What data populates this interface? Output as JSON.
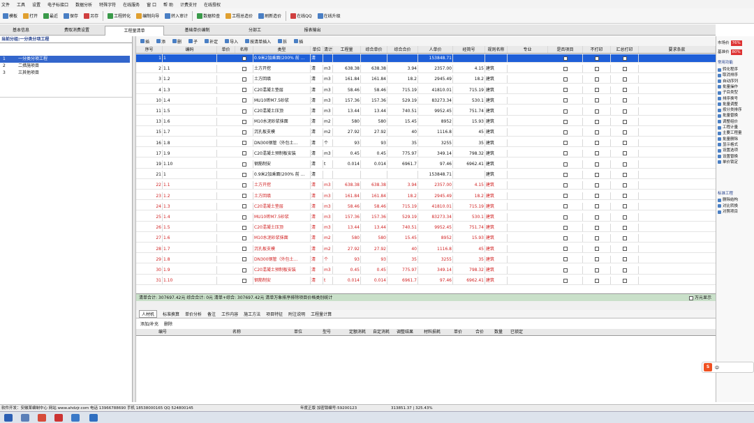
{
  "menu": [
    "文件",
    "工具",
    "设置",
    "电子标接口",
    "数据分析",
    "特殊字符",
    "在线服务",
    "窗 口",
    "帮 助",
    "计费支付",
    "在线授权"
  ],
  "toolbar": [
    {
      "icon": "template-icon",
      "label": "模板"
    },
    {
      "icon": "open-icon",
      "label": "打开"
    },
    {
      "icon": "recent-icon",
      "label": "最近"
    },
    {
      "icon": "save-icon",
      "label": "保存"
    },
    {
      "icon": "save-as-icon",
      "label": "另存"
    },
    {
      "icon": "engineering-icon",
      "label": "工程转化"
    },
    {
      "icon": "wizard-icon",
      "label": "编制向导"
    },
    {
      "icon": "import-icon",
      "label": "转入审计"
    },
    {
      "icon": "check-icon",
      "label": "数据检查"
    },
    {
      "icon": "unit-price-icon",
      "label": "工程总造价"
    },
    {
      "icon": "refresh-icon",
      "label": "刷新造价"
    },
    {
      "icon": "online-icon",
      "label": "在线QQ"
    },
    {
      "icon": "online-upgrade-icon",
      "label": "在线升级"
    }
  ],
  "tabs": [
    "基本信息",
    "费取消费设置",
    "工程量清单",
    "基础单价编制",
    "分部工",
    "报表输出"
  ],
  "left": {
    "header": "当前分组:一分类分项工程",
    "rows": [
      {
        "num": "1",
        "label": "一分类分项工程"
      },
      {
        "num": "2",
        "label": "二措施项目"
      },
      {
        "num": "3",
        "label": "三其他项目"
      }
    ]
  },
  "gridtool": [
    "插",
    "添",
    "删",
    "子",
    "补定",
    "导入",
    "按清单插入",
    "拆",
    "插"
  ],
  "columns": [
    "序号",
    "编码",
    "单价",
    "名称",
    "类型",
    "单位",
    "清计算式",
    "工程量",
    "综合单价",
    "综合合价",
    "人单价",
    "经简号",
    "规则名称",
    "专业",
    "是否项目",
    "不打印",
    "汇总打印",
    "要求条款"
  ],
  "rows": [
    {
      "n": "1",
      "code": "1",
      "name": "0.9米2加乘面(200% 前 ...",
      "type": "清",
      "unit": "",
      "exp": "",
      "qty": "",
      "price": "",
      "total": "153848.71",
      "ren": "",
      "cat": "",
      "tag": "",
      "sel": true,
      "red": false
    },
    {
      "n": "2",
      "code": "1.1",
      "name": "土方开挖",
      "type": "清",
      "unit": "m3",
      "exp": "638.38",
      "qty": "638.38",
      "price": "3.94",
      "total": "2357.00",
      "ren": "4.15",
      "cat": "建筑"
    },
    {
      "n": "3",
      "code": "1.2",
      "name": "土方回填",
      "type": "清",
      "unit": "m3",
      "exp": "161.84",
      "qty": "161.84",
      "price": "18.2",
      "total": "2945.49",
      "ren": "18.2",
      "cat": "建筑"
    },
    {
      "n": "4",
      "code": "1.3",
      "name": "C20混凝土垫层",
      "type": "清",
      "unit": "m3",
      "exp": "58.46",
      "qty": "58.46",
      "price": "715.19",
      "total": "41810.01",
      "ren": "715.19",
      "cat": "建筑"
    },
    {
      "n": "10",
      "code": "1.4",
      "name": "MU10砖M7.5砂浆",
      "type": "清",
      "unit": "m3",
      "exp": "157.36",
      "qty": "157.36",
      "price": "529.19",
      "total": "83273.34",
      "ren": "530.1",
      "cat": "建筑"
    },
    {
      "n": "11",
      "code": "1.5",
      "name": "C20混凝土压顶",
      "type": "清",
      "unit": "m3",
      "exp": "13.44",
      "qty": "13.44",
      "price": "740.51",
      "total": "9952.45",
      "ren": "751.74",
      "cat": "建筑"
    },
    {
      "n": "13",
      "code": "1.6",
      "name": "M10水泥砂浆抹面",
      "type": "清",
      "unit": "m2",
      "exp": "580",
      "qty": "580",
      "price": "15.45",
      "total": "8952",
      "ren": "15.93",
      "cat": "建筑"
    },
    {
      "n": "15",
      "code": "1.7",
      "name": "沉孔板支模",
      "type": "清",
      "unit": "m2",
      "exp": "27.92",
      "qty": "27.92",
      "price": "40",
      "total": "1116.8",
      "ren": "45",
      "cat": "建筑"
    },
    {
      "n": "16",
      "code": "1.8",
      "name": "DN300钢管（外包土...",
      "type": "清",
      "unit": "个",
      "exp": "93",
      "qty": "93",
      "price": "35",
      "total": "3255",
      "ren": "35",
      "cat": "建筑"
    },
    {
      "n": "17",
      "code": "1.9",
      "name": "C20混凝土预制板安装",
      "type": "清",
      "unit": "m3",
      "exp": "0.45",
      "qty": "0.45",
      "price": "775.97",
      "total": "349.14",
      "ren": "798.32",
      "cat": "建筑"
    },
    {
      "n": "19",
      "code": "1.10",
      "name": "钢筋制安",
      "type": "清",
      "unit": "t",
      "exp": "0.014",
      "qty": "0.014",
      "price": "6961.7",
      "total": "97.46",
      "ren": "6962.41",
      "cat": "建筑"
    },
    {
      "n": "21",
      "code": "1",
      "name": "0.9米2加乘面(200% 前 ...",
      "type": "清",
      "unit": "",
      "exp": "",
      "qty": "",
      "price": "",
      "total": "153848.71",
      "ren": "",
      "cat": "建筑"
    },
    {
      "n": "22",
      "code": "1.1",
      "name": "土方开挖",
      "type": "清",
      "unit": "m3",
      "exp": "638.38",
      "qty": "638.38",
      "price": "3.94",
      "total": "2357.00",
      "ren": "4.15",
      "cat": "建筑",
      "red": true
    },
    {
      "n": "23",
      "code": "1.2",
      "name": "土方回填",
      "type": "清",
      "unit": "m3",
      "exp": "161.84",
      "qty": "161.84",
      "price": "18.2",
      "total": "2945.49",
      "ren": "18.2",
      "cat": "建筑",
      "red": true
    },
    {
      "n": "24",
      "code": "1.3",
      "name": "C20混凝土垫层",
      "type": "清",
      "unit": "m3",
      "exp": "58.46",
      "qty": "58.46",
      "price": "715.19",
      "total": "41810.01",
      "ren": "715.19",
      "cat": "建筑",
      "red": true
    },
    {
      "n": "25",
      "code": "1.4",
      "name": "MU10砖M7.5砂浆",
      "type": "清",
      "unit": "m3",
      "exp": "157.36",
      "qty": "157.36",
      "price": "529.19",
      "total": "83273.34",
      "ren": "530.1",
      "cat": "建筑",
      "red": true
    },
    {
      "n": "26",
      "code": "1.5",
      "name": "C20混凝土压顶",
      "type": "清",
      "unit": "m3",
      "exp": "13.44",
      "qty": "13.44",
      "price": "740.51",
      "total": "9952.45",
      "ren": "751.74",
      "cat": "建筑",
      "red": true
    },
    {
      "n": "27",
      "code": "1.6",
      "name": "M10水泥砂浆抹面",
      "type": "清",
      "unit": "m2",
      "exp": "580",
      "qty": "580",
      "price": "15.45",
      "total": "8952",
      "ren": "15.93",
      "cat": "建筑",
      "red": true
    },
    {
      "n": "28",
      "code": "1.7",
      "name": "沉孔板支模",
      "type": "清",
      "unit": "m2",
      "exp": "27.92",
      "qty": "27.92",
      "price": "40",
      "total": "1116.8",
      "ren": "45",
      "cat": "建筑",
      "red": true
    },
    {
      "n": "29",
      "code": "1.8",
      "name": "DN300钢管（外包土...",
      "type": "清",
      "unit": "个",
      "exp": "93",
      "qty": "93",
      "price": "35",
      "total": "3255",
      "ren": "35",
      "cat": "建筑",
      "red": true
    },
    {
      "n": "30",
      "code": "1.9",
      "name": "C20混凝土预制板安装",
      "type": "清",
      "unit": "m3",
      "exp": "0.45",
      "qty": "0.45",
      "price": "775.97",
      "total": "349.14",
      "ren": "798.32",
      "cat": "建筑",
      "red": true
    },
    {
      "n": "31",
      "code": "1.10",
      "name": "钢筋制安",
      "type": "清",
      "unit": "t",
      "exp": "0.014",
      "qty": "0.014",
      "price": "6961.7",
      "total": "97.46",
      "ren": "6962.41",
      "cat": "建筑",
      "red": true
    }
  ],
  "summary": "清单合计: 307697.42元  综合合计: 0元  清单+综合: 307697.42元  清单万象排序排除项目价格类别统计",
  "summary_check": "万元显示",
  "bottom_tabs": [
    "人材机",
    "标准换算",
    "单价分析",
    "备注",
    "工作内容",
    "施工方法",
    "项目特征",
    "附注说明",
    "工程量计算"
  ],
  "bottom_tools": [
    "添加/补充",
    "删除"
  ],
  "bottom_cols": [
    "编号",
    "名称",
    "单位",
    "型号",
    "定额消耗",
    "自定消耗",
    "调整结果",
    "材料损耗",
    "单价",
    "合价",
    "数量",
    "已锁定"
  ],
  "right": {
    "top": [
      {
        "label": "市场价",
        "val": "76%"
      },
      {
        "label": "基准价",
        "val": "80%"
      }
    ],
    "group1": "常用功能",
    "items1": [
      "转化程序",
      "取消排序",
      "自动序列",
      "批量操作",
      "子目类型",
      "排序换号",
      "批量调整",
      "按分类排序",
      "批量替换",
      "调整组价",
      "工程计量",
      "主要工程量",
      "批量删除",
      "显示格式",
      "设置选项",
      "设置替换",
      "单价锁定"
    ],
    "group2": "标准工程",
    "items2": [
      "删除结构",
      "对比转换",
      "对照项目"
    ]
  },
  "status": "软件开发：安徽某编制中心 网站 www.ahdzjr.com 电话 13966788690 手机 18538000165 QQ 524800145",
  "status2": "年度正版 加密锁编号:59200123",
  "status3": "313851.37 | 325.43%",
  "colors": {
    "selected": "#1e5fd8",
    "red": "#d02020",
    "summary_bg": "#c9e0c9"
  }
}
